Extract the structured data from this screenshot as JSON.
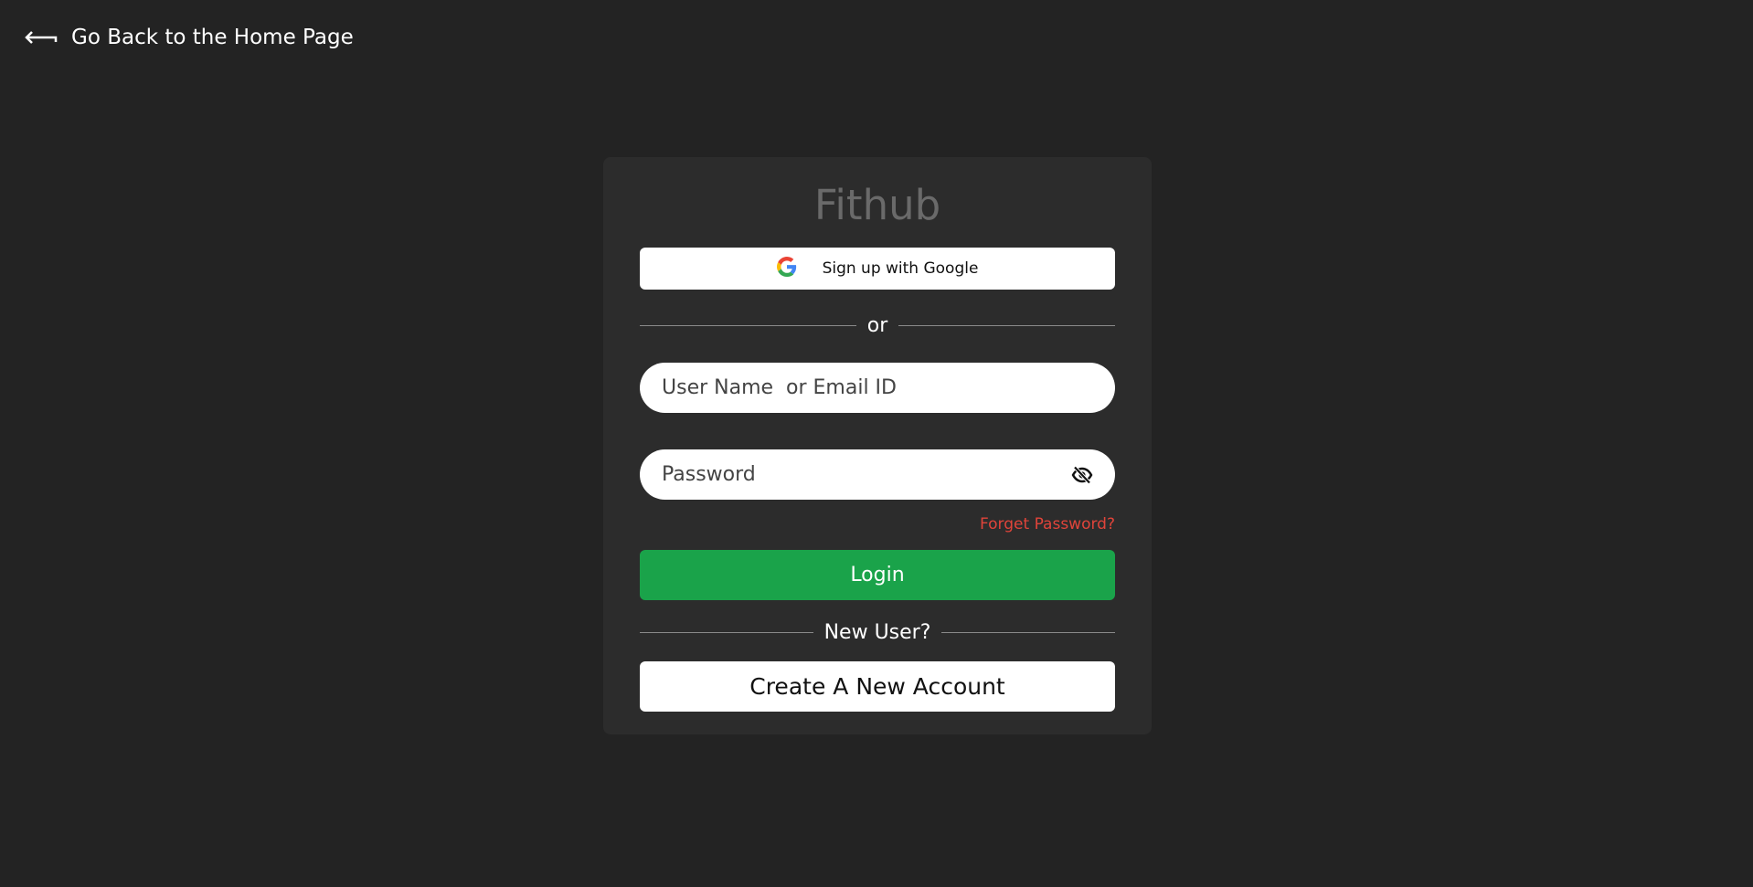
{
  "nav": {
    "back_label": "Go Back to the Home Page",
    "back_icon": "arrow-left-return-icon"
  },
  "card": {
    "brand": "Fithub",
    "google_button_label": "Sign up with Google",
    "google_icon": "google-icon",
    "or_label": "or",
    "username_placeholder": "User Name  or Email ID",
    "password_placeholder": "Password",
    "password_toggle_icon": "eye-slash-icon",
    "forgot_label": "Forget Password?",
    "login_label": "Login",
    "new_user_label": "New User?",
    "create_account_label": "Create A New Account"
  },
  "colors": {
    "background": "#232323",
    "card": "#2c2c2c",
    "brand_text": "#6a6a6a",
    "login_green": "#1aa34a",
    "forgot_red": "#e0443a"
  }
}
